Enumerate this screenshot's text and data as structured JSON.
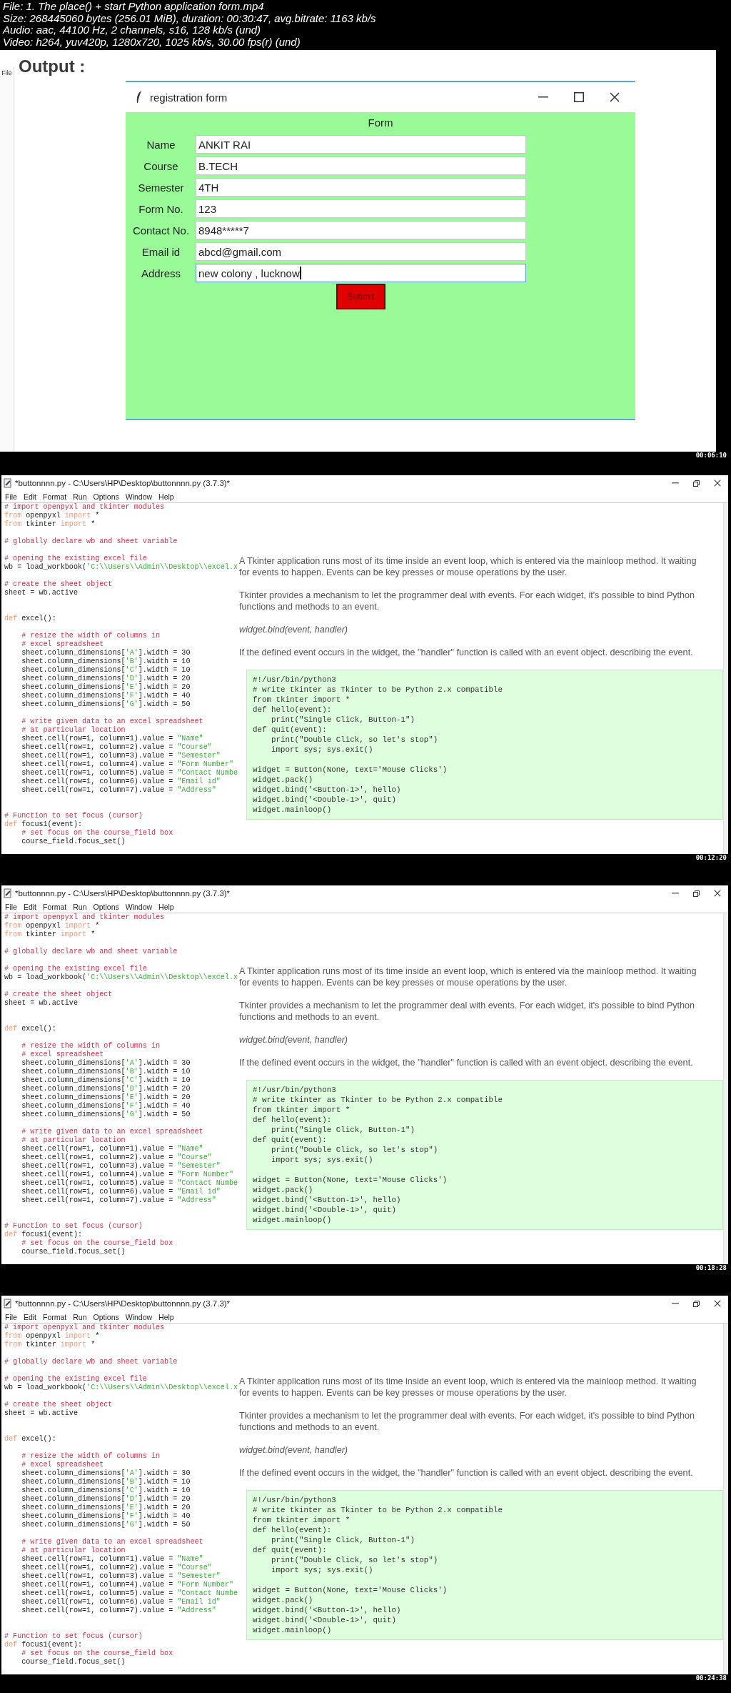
{
  "file_info": [
    "File: 1. The place() + start  Python application form.mp4",
    "Size: 268445060 bytes (256.01 MiB), duration: 00:30:47, avg.bitrate: 1163 kb/s",
    "Audio: aac, 44100 Hz, 2 channels, s16, 128 kb/s (und)",
    "Video: h264, yuv420p, 1280x720, 1025 kb/s, 30.00 fps(r) (und)"
  ],
  "frames": [
    {
      "kind": "output",
      "heading": "Output :",
      "background_menu": "File",
      "window": {
        "title": "registration form",
        "form_title": "Form",
        "fields": [
          {
            "label": "Name",
            "value": "ANKIT RAI",
            "focused": false
          },
          {
            "label": "Course",
            "value": "B.TECH",
            "focused": false
          },
          {
            "label": "Semester",
            "value": "4TH",
            "focused": false
          },
          {
            "label": "Form No.",
            "value": "123",
            "focused": false
          },
          {
            "label": "Contact No.",
            "value": "8948*****7",
            "focused": false
          },
          {
            "label": "Email id",
            "value": "abcd@gmail.com",
            "focused": false
          },
          {
            "label": "Address",
            "value": "new colony , lucknow",
            "focused": true
          }
        ],
        "button": "Submit"
      },
      "timestamp": "00:06:10"
    },
    {
      "kind": "editor",
      "window_title": "*buttonnnn.py - C:\\Users\\HP\\Desktop\\buttonnnn.py (3.7.3)*",
      "menu": [
        "File",
        "Edit",
        "Format",
        "Run",
        "Options",
        "Window",
        "Help"
      ],
      "code": [
        {
          "kind": "statements",
          "lines": [
            [
              {
                "kind": "comment",
                "text": "# import openpyxl and tkinter modules"
              }
            ],
            [
              {
                "kind": "keyword",
                "text": "from"
              },
              {
                "kind": "plain",
                "text": " openpyxl "
              },
              {
                "kind": "keyword",
                "text": "import"
              },
              {
                "kind": "plain",
                "text": " *"
              }
            ],
            [
              {
                "kind": "keyword",
                "text": "from"
              },
              {
                "kind": "plain",
                "text": " tkinter "
              },
              {
                "kind": "keyword",
                "text": "import"
              },
              {
                "kind": "plain",
                "text": " *"
              }
            ]
          ]
        },
        {
          "kind": "statements",
          "lines": [
            [
              {
                "kind": "comment",
                "text": "# globally declare wb and sheet variable"
              }
            ]
          ]
        },
        {
          "kind": "statements",
          "lines": [
            [
              {
                "kind": "comment",
                "text": "# opening the existing excel file"
              }
            ],
            [
              {
                "kind": "plain",
                "text": "wb = load_workbook("
              },
              {
                "kind": "string",
                "text": "'C:\\\\Users\\\\Admin\\\\Desktop\\\\excel.x"
              }
            ]
          ]
        },
        {
          "kind": "statements",
          "lines": [
            [
              {
                "kind": "comment",
                "text": "# create the sheet object"
              }
            ],
            [
              {
                "kind": "plain",
                "text": "sheet = wb.active"
              }
            ]
          ]
        },
        {
          "kind": "function",
          "lines": [
            [
              {
                "kind": "keyword",
                "text": "def"
              },
              {
                "kind": "plain",
                "text": " excel():"
              }
            ]
          ],
          "body": [
            [
              [
                {
                  "kind": "comment",
                  "text": "    # resize the width of columns in"
                }
              ],
              [
                {
                  "kind": "comment",
                  "text": "    # excel spreadsheet"
                }
              ],
              [
                {
                  "kind": "plain",
                  "text": "    sheet.column_dimensions["
                },
                {
                  "kind": "string",
                  "text": "'A'"
                },
                {
                  "kind": "plain",
                  "text": "].width = 30"
                }
              ],
              [
                {
                  "kind": "plain",
                  "text": "    sheet.column_dimensions["
                },
                {
                  "kind": "string",
                  "text": "'B'"
                },
                {
                  "kind": "plain",
                  "text": "].width = 10"
                }
              ],
              [
                {
                  "kind": "plain",
                  "text": "    sheet.column_dimensions["
                },
                {
                  "kind": "string",
                  "text": "'C'"
                },
                {
                  "kind": "plain",
                  "text": "].width = 10"
                }
              ],
              [
                {
                  "kind": "plain",
                  "text": "    sheet.column_dimensions["
                },
                {
                  "kind": "string",
                  "text": "'D'"
                },
                {
                  "kind": "plain",
                  "text": "].width = 20"
                }
              ],
              [
                {
                  "kind": "plain",
                  "text": "    sheet.column_dimensions["
                },
                {
                  "kind": "string",
                  "text": "'E'"
                },
                {
                  "kind": "plain",
                  "text": "].width = 20"
                }
              ],
              [
                {
                  "kind": "plain",
                  "text": "    sheet.column_dimensions["
                },
                {
                  "kind": "string",
                  "text": "'F'"
                },
                {
                  "kind": "plain",
                  "text": "].width = 40"
                }
              ],
              [
                {
                  "kind": "plain",
                  "text": "    sheet.column_dimensions["
                },
                {
                  "kind": "string",
                  "text": "'G'"
                },
                {
                  "kind": "plain",
                  "text": "].width = 50"
                }
              ]
            ],
            [
              [
                {
                  "kind": "comment",
                  "text": "    # write given data to an excel spreadsheet"
                }
              ],
              [
                {
                  "kind": "comment",
                  "text": "    # at particular location"
                }
              ],
              [
                {
                  "kind": "plain",
                  "text": "    sheet.cell(row=1, column=1).value = "
                },
                {
                  "kind": "string",
                  "text": "\"Name\""
                }
              ],
              [
                {
                  "kind": "plain",
                  "text": "    sheet.cell(row=1, column=2).value = "
                },
                {
                  "kind": "string",
                  "text": "\"Course\""
                }
              ],
              [
                {
                  "kind": "plain",
                  "text": "    sheet.cell(row=1, column=3).value = "
                },
                {
                  "kind": "string",
                  "text": "\"Semester\""
                }
              ],
              [
                {
                  "kind": "plain",
                  "text": "    sheet.cell(row=1, column=4).value = "
                },
                {
                  "kind": "string",
                  "text": "\"Form Number\""
                }
              ],
              [
                {
                  "kind": "plain",
                  "text": "    sheet.cell(row=1, column=5).value = "
                },
                {
                  "kind": "string",
                  "text": "\"Contact Numbe"
                }
              ],
              [
                {
                  "kind": "plain",
                  "text": "    sheet.cell(row=1, column=6).value = "
                },
                {
                  "kind": "string",
                  "text": "\"Email id\""
                }
              ],
              [
                {
                  "kind": "plain",
                  "text": "    sheet.cell(row=1, column=7).value = "
                },
                {
                  "kind": "string",
                  "text": "\"Address\""
                }
              ]
            ]
          ]
        },
        {
          "kind": "function",
          "lines": [
            [
              {
                "kind": "comment",
                "text": "# Function to set focus (cursor)"
              }
            ],
            [
              {
                "kind": "keyword",
                "text": "def"
              },
              {
                "kind": "plain",
                "text": " focus1(event):"
              }
            ],
            [
              {
                "kind": "comment",
                "text": "    # set focus on the course_field box"
              }
            ],
            [
              {
                "kind": "plain",
                "text": "    course_field.focus_set()"
              }
            ]
          ]
        }
      ],
      "article": [
        {
          "kind": "text",
          "text": "A Tkinter application runs most of its time inside an event loop, which is entered via the mainloop method. It waiting for events to happen. Events can be key presses or mouse operations by the user."
        },
        {
          "kind": "text",
          "text": "Tkinter provides a mechanism to let the programmer deal with events. For each widget, it's possible to bind Python functions and methods to an event."
        },
        {
          "kind": "signature",
          "text": "widget.bind(event, handler)"
        },
        {
          "kind": "text",
          "text": "If the defined event occurs in the widget, the \"handler\" function is called with an event object. describing the event."
        }
      ],
      "example_code": [
        [
          "#!/usr/bin/python3",
          "# write tkinter as Tkinter to be Python 2.x compatible",
          "from tkinter import *",
          "def hello(event):",
          "    print(\"Single Click, Button-1\")",
          "def quit(event):",
          "    print(\"Double Click, so let's stop\")",
          "    import sys; sys.exit()"
        ],
        [
          "widget = Button(None, text='Mouse Clicks')",
          "widget.pack()",
          "widget.bind('<Button-1>', hello)",
          "widget.bind('<Double-1>', quit)",
          "widget.mainloop()"
        ]
      ],
      "timestamp": "00:12:20"
    },
    {
      "kind": "editor",
      "window_title": "*buttonnnn.py - C:\\Users\\HP\\Desktop\\buttonnnn.py (3.7.3)*",
      "menu": [
        "File",
        "Edit",
        "Format",
        "Run",
        "Options",
        "Window",
        "Help"
      ],
      "code": [
        {
          "kind": "statements",
          "lines": [
            [
              {
                "kind": "comment",
                "text": "# import openpyxl and tkinter modules"
              }
            ],
            [
              {
                "kind": "keyword",
                "text": "from"
              },
              {
                "kind": "plain",
                "text": " openpyxl "
              },
              {
                "kind": "keyword",
                "text": "import"
              },
              {
                "kind": "plain",
                "text": " *"
              }
            ],
            [
              {
                "kind": "keyword",
                "text": "from"
              },
              {
                "kind": "plain",
                "text": " tkinter "
              },
              {
                "kind": "keyword",
                "text": "import"
              },
              {
                "kind": "plain",
                "text": " *"
              }
            ]
          ]
        },
        {
          "kind": "statements",
          "lines": [
            [
              {
                "kind": "comment",
                "text": "# globally declare wb and sheet variable"
              }
            ]
          ]
        },
        {
          "kind": "statements",
          "lines": [
            [
              {
                "kind": "comment",
                "text": "# opening the existing excel file"
              }
            ],
            [
              {
                "kind": "plain",
                "text": "wb = load_workbook("
              },
              {
                "kind": "string",
                "text": "'C:\\\\Users\\\\Admin\\\\Desktop\\\\excel.x"
              }
            ]
          ]
        },
        {
          "kind": "statements",
          "lines": [
            [
              {
                "kind": "comment",
                "text": "# create the sheet object"
              }
            ],
            [
              {
                "kind": "plain",
                "text": "sheet = wb.active"
              }
            ]
          ]
        },
        {
          "kind": "function",
          "lines": [
            [
              {
                "kind": "keyword",
                "text": "def"
              },
              {
                "kind": "plain",
                "text": " excel():"
              }
            ]
          ],
          "body": [
            [
              [
                {
                  "kind": "comment",
                  "text": "    # resize the width of columns in"
                }
              ],
              [
                {
                  "kind": "comment",
                  "text": "    # excel spreadsheet"
                }
              ],
              [
                {
                  "kind": "plain",
                  "text": "    sheet.column_dimensions["
                },
                {
                  "kind": "string",
                  "text": "'A'"
                },
                {
                  "kind": "plain",
                  "text": "].width = 30"
                }
              ],
              [
                {
                  "kind": "plain",
                  "text": "    sheet.column_dimensions["
                },
                {
                  "kind": "string",
                  "text": "'B'"
                },
                {
                  "kind": "plain",
                  "text": "].width = 10"
                }
              ],
              [
                {
                  "kind": "plain",
                  "text": "    sheet.column_dimensions["
                },
                {
                  "kind": "string",
                  "text": "'C'"
                },
                {
                  "kind": "plain",
                  "text": "].width = 10"
                }
              ],
              [
                {
                  "kind": "plain",
                  "text": "    sheet.column_dimensions["
                },
                {
                  "kind": "string",
                  "text": "'D'"
                },
                {
                  "kind": "plain",
                  "text": "].width = 20"
                }
              ],
              [
                {
                  "kind": "plain",
                  "text": "    sheet.column_dimensions["
                },
                {
                  "kind": "string",
                  "text": "'E'"
                },
                {
                  "kind": "plain",
                  "text": "].width = 20"
                }
              ],
              [
                {
                  "kind": "plain",
                  "text": "    sheet.column_dimensions["
                },
                {
                  "kind": "string",
                  "text": "'F'"
                },
                {
                  "kind": "plain",
                  "text": "].width = 40"
                }
              ],
              [
                {
                  "kind": "plain",
                  "text": "    sheet.column_dimensions["
                },
                {
                  "kind": "string",
                  "text": "'G'"
                },
                {
                  "kind": "plain",
                  "text": "].width = 50"
                }
              ]
            ],
            [
              [
                {
                  "kind": "comment",
                  "text": "    # write given data to an excel spreadsheet"
                }
              ],
              [
                {
                  "kind": "comment",
                  "text": "    # at particular location"
                }
              ],
              [
                {
                  "kind": "plain",
                  "text": "    sheet.cell(row=1, column=1).value = "
                },
                {
                  "kind": "string",
                  "text": "\"Name\""
                }
              ],
              [
                {
                  "kind": "plain",
                  "text": "    sheet.cell(row=1, column=2).value = "
                },
                {
                  "kind": "string",
                  "text": "\"Course\""
                }
              ],
              [
                {
                  "kind": "plain",
                  "text": "    sheet.cell(row=1, column=3).value = "
                },
                {
                  "kind": "string",
                  "text": "\"Semester\""
                }
              ],
              [
                {
                  "kind": "plain",
                  "text": "    sheet.cell(row=1, column=4).value = "
                },
                {
                  "kind": "string",
                  "text": "\"Form Number\""
                }
              ],
              [
                {
                  "kind": "plain",
                  "text": "    sheet.cell(row=1, column=5).value = "
                },
                {
                  "kind": "string",
                  "text": "\"Contact Numbe"
                }
              ],
              [
                {
                  "kind": "plain",
                  "text": "    sheet.cell(row=1, column=6).value = "
                },
                {
                  "kind": "string",
                  "text": "\"Email id\""
                }
              ],
              [
                {
                  "kind": "plain",
                  "text": "    sheet.cell(row=1, column=7).value = "
                },
                {
                  "kind": "string",
                  "text": "\"Address\""
                }
              ]
            ]
          ]
        },
        {
          "kind": "function",
          "lines": [
            [
              {
                "kind": "comment",
                "text": "# Function to set focus (cursor)"
              }
            ],
            [
              {
                "kind": "keyword",
                "text": "def"
              },
              {
                "kind": "plain",
                "text": " focus1(event):"
              }
            ],
            [
              {
                "kind": "comment",
                "text": "    # set focus on the course_field box"
              }
            ],
            [
              {
                "kind": "plain",
                "text": "    course_field.focus_set()"
              }
            ]
          ]
        }
      ],
      "article": [
        {
          "kind": "text",
          "text": "A Tkinter application runs most of its time inside an event loop, which is entered via the mainloop method. It waiting for events to happen. Events can be key presses or mouse operations by the user."
        },
        {
          "kind": "text",
          "text": "Tkinter provides a mechanism to let the programmer deal with events. For each widget, it's possible to bind Python functions and methods to an event."
        },
        {
          "kind": "signature",
          "text": "widget.bind(event, handler)"
        },
        {
          "kind": "text",
          "text": "If the defined event occurs in the widget, the \"handler\" function is called with an event object. describing the event."
        }
      ],
      "example_code": [
        [
          "#!/usr/bin/python3",
          "# write tkinter as Tkinter to be Python 2.x compatible",
          "from tkinter import *",
          "def hello(event):",
          "    print(\"Single Click, Button-1\")",
          "def quit(event):",
          "    print(\"Double Click, so let's stop\")",
          "    import sys; sys.exit()"
        ],
        [
          "widget = Button(None, text='Mouse Clicks')",
          "widget.pack()",
          "widget.bind('<Button-1>', hello)",
          "widget.bind('<Double-1>', quit)",
          "widget.mainloop()"
        ]
      ],
      "timestamp": "00:18:28"
    },
    {
      "kind": "editor",
      "window_title": "*buttonnnn.py - C:\\Users\\HP\\Desktop\\buttonnnn.py (3.7.3)*",
      "menu": [
        "File",
        "Edit",
        "Format",
        "Run",
        "Options",
        "Window",
        "Help"
      ],
      "code": [
        {
          "kind": "statements",
          "lines": [
            [
              {
                "kind": "comment",
                "text": "# import openpyxl and tkinter modules"
              }
            ],
            [
              {
                "kind": "keyword",
                "text": "from"
              },
              {
                "kind": "plain",
                "text": " openpyxl "
              },
              {
                "kind": "keyword",
                "text": "import"
              },
              {
                "kind": "plain",
                "text": " *"
              }
            ],
            [
              {
                "kind": "keyword",
                "text": "from"
              },
              {
                "kind": "plain",
                "text": " tkinter "
              },
              {
                "kind": "keyword",
                "text": "import"
              },
              {
                "kind": "plain",
                "text": " *"
              }
            ]
          ]
        },
        {
          "kind": "statements",
          "lines": [
            [
              {
                "kind": "comment",
                "text": "# globally declare wb and sheet variable"
              }
            ]
          ]
        },
        {
          "kind": "statements",
          "lines": [
            [
              {
                "kind": "comment",
                "text": "# opening the existing excel file"
              }
            ],
            [
              {
                "kind": "plain",
                "text": "wb = load_workbook("
              },
              {
                "kind": "string",
                "text": "'C:\\\\Users\\\\Admin\\\\Desktop\\\\excel.x"
              }
            ]
          ]
        },
        {
          "kind": "statements",
          "lines": [
            [
              {
                "kind": "comment",
                "text": "# create the sheet object"
              }
            ],
            [
              {
                "kind": "plain",
                "text": "sheet = wb.active"
              }
            ]
          ]
        },
        {
          "kind": "function",
          "lines": [
            [
              {
                "kind": "keyword",
                "text": "def"
              },
              {
                "kind": "plain",
                "text": " excel():"
              }
            ]
          ],
          "body": [
            [
              [
                {
                  "kind": "comment",
                  "text": "    # resize the width of columns in"
                }
              ],
              [
                {
                  "kind": "comment",
                  "text": "    # excel spreadsheet"
                }
              ],
              [
                {
                  "kind": "plain",
                  "text": "    sheet.column_dimensions["
                },
                {
                  "kind": "string",
                  "text": "'A'"
                },
                {
                  "kind": "plain",
                  "text": "].width = 30"
                }
              ],
              [
                {
                  "kind": "plain",
                  "text": "    sheet.column_dimensions["
                },
                {
                  "kind": "string",
                  "text": "'B'"
                },
                {
                  "kind": "plain",
                  "text": "].width = 10"
                }
              ],
              [
                {
                  "kind": "plain",
                  "text": "    sheet.column_dimensions["
                },
                {
                  "kind": "string",
                  "text": "'C'"
                },
                {
                  "kind": "plain",
                  "text": "].width = 10"
                }
              ],
              [
                {
                  "kind": "plain",
                  "text": "    sheet.column_dimensions["
                },
                {
                  "kind": "string",
                  "text": "'D'"
                },
                {
                  "kind": "plain",
                  "text": "].width = 20"
                }
              ],
              [
                {
                  "kind": "plain",
                  "text": "    sheet.column_dimensions["
                },
                {
                  "kind": "string",
                  "text": "'E'"
                },
                {
                  "kind": "plain",
                  "text": "].width = 20"
                }
              ],
              [
                {
                  "kind": "plain",
                  "text": "    sheet.column_dimensions["
                },
                {
                  "kind": "string",
                  "text": "'F'"
                },
                {
                  "kind": "plain",
                  "text": "].width = 40"
                }
              ],
              [
                {
                  "kind": "plain",
                  "text": "    sheet.column_dimensions["
                },
                {
                  "kind": "string",
                  "text": "'G'"
                },
                {
                  "kind": "plain",
                  "text": "].width = 50"
                }
              ]
            ],
            [
              [
                {
                  "kind": "comment",
                  "text": "    # write given data to an excel spreadsheet"
                }
              ],
              [
                {
                  "kind": "comment",
                  "text": "    # at particular location"
                }
              ],
              [
                {
                  "kind": "plain",
                  "text": "    sheet.cell(row=1, column=1).value = "
                },
                {
                  "kind": "string",
                  "text": "\"Name\""
                }
              ],
              [
                {
                  "kind": "plain",
                  "text": "    sheet.cell(row=1, column=2).value = "
                },
                {
                  "kind": "string",
                  "text": "\"Course\""
                }
              ],
              [
                {
                  "kind": "plain",
                  "text": "    sheet.cell(row=1, column=3).value = "
                },
                {
                  "kind": "string",
                  "text": "\"Semester\""
                }
              ],
              [
                {
                  "kind": "plain",
                  "text": "    sheet.cell(row=1, column=4).value = "
                },
                {
                  "kind": "string",
                  "text": "\"Form Number\""
                }
              ],
              [
                {
                  "kind": "plain",
                  "text": "    sheet.cell(row=1, column=5).value = "
                },
                {
                  "kind": "string",
                  "text": "\"Contact Numbe"
                }
              ],
              [
                {
                  "kind": "plain",
                  "text": "    sheet.cell(row=1, column=6).value = "
                },
                {
                  "kind": "string",
                  "text": "\"Email id\""
                }
              ],
              [
                {
                  "kind": "plain",
                  "text": "    sheet.cell(row=1, column=7).value = "
                },
                {
                  "kind": "string",
                  "text": "\"Address\""
                }
              ]
            ]
          ]
        },
        {
          "kind": "function",
          "lines": [
            [
              {
                "kind": "comment",
                "text": "# Function to set focus (cursor)"
              }
            ],
            [
              {
                "kind": "keyword",
                "text": "def"
              },
              {
                "kind": "plain",
                "text": " focus1(event):"
              }
            ],
            [
              {
                "kind": "comment",
                "text": "    # set focus on the course_field box"
              }
            ],
            [
              {
                "kind": "plain",
                "text": "    course_field.focus_set()"
              }
            ]
          ]
        }
      ],
      "article": [
        {
          "kind": "text",
          "text": "A Tkinter application runs most of its time inside an event loop, which is entered via the mainloop method. It waiting for events to happen. Events can be key presses or mouse operations by the user."
        },
        {
          "kind": "text",
          "text": "Tkinter provides a mechanism to let the programmer deal with events. For each widget, it's possible to bind Python functions and methods to an event."
        },
        {
          "kind": "signature",
          "text": "widget.bind(event, handler)"
        },
        {
          "kind": "text",
          "text": "If the defined event occurs in the widget, the \"handler\" function is called with an event object. describing the event."
        }
      ],
      "example_code": [
        [
          "#!/usr/bin/python3",
          "# write tkinter as Tkinter to be Python 2.x compatible",
          "from tkinter import *",
          "def hello(event):",
          "    print(\"Single Click, Button-1\")",
          "def quit(event):",
          "    print(\"Double Click, so let's stop\")",
          "    import sys; sys.exit()"
        ],
        [
          "widget = Button(None, text='Mouse Clicks')",
          "widget.pack()",
          "widget.bind('<Button-1>', hello)",
          "widget.bind('<Double-1>', quit)",
          "widget.mainloop()"
        ]
      ],
      "timestamp": "00:24:38"
    }
  ]
}
